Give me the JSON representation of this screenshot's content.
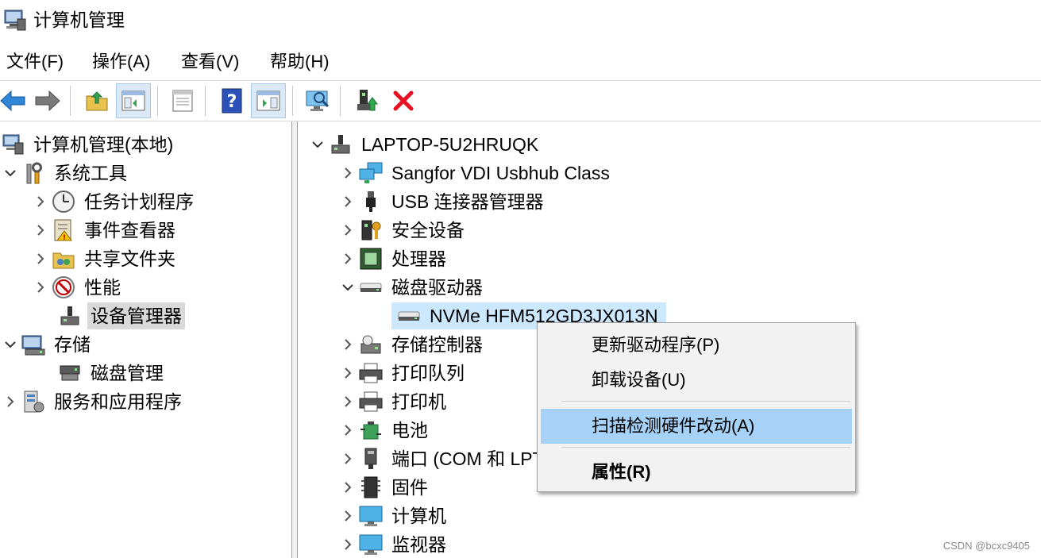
{
  "window": {
    "title": "计算机管理"
  },
  "menu": [
    "文件(F)",
    "操作(A)",
    "查看(V)",
    "帮助(H)"
  ],
  "left_tree": {
    "root": "计算机管理(本地)",
    "system_tools": "系统工具",
    "task_scheduler": "任务计划程序",
    "event_viewer": "事件查看器",
    "shared_folders": "共享文件夹",
    "performance": "性能",
    "device_manager": "设备管理器",
    "storage": "存储",
    "disk_management": "磁盘管理",
    "services_apps": "服务和应用程序"
  },
  "right_tree": {
    "computer": "LAPTOP-5U2HRUQK",
    "items": {
      "sangfor": "Sangfor VDI Usbhub Class",
      "usb_connector": "USB 连接器管理器",
      "security": "安全设备",
      "processor": "处理器",
      "disk_drives": "磁盘驱动器",
      "nvme": "NVMe HFM512GD3JX013N",
      "storage_ctrl": "存储控制器",
      "print_queue": "打印队列",
      "printer": "打印机",
      "battery": "电池",
      "ports": "端口 (COM 和 LPT)",
      "firmware": "固件",
      "computer_cat": "计算机",
      "monitor": "监视器"
    }
  },
  "context_menu": {
    "update_driver": "更新驱动程序(P)",
    "uninstall": "卸载设备(U)",
    "scan": "扫描检测硬件改动(A)",
    "properties": "属性(R)"
  },
  "watermark": "CSDN @bcxc9405",
  "colors": {
    "selected_gray": "#d9d9d9",
    "selected_blue": "#cce8ff",
    "menu_hover": "#a6d2f7",
    "delete_red": "#e81123"
  }
}
